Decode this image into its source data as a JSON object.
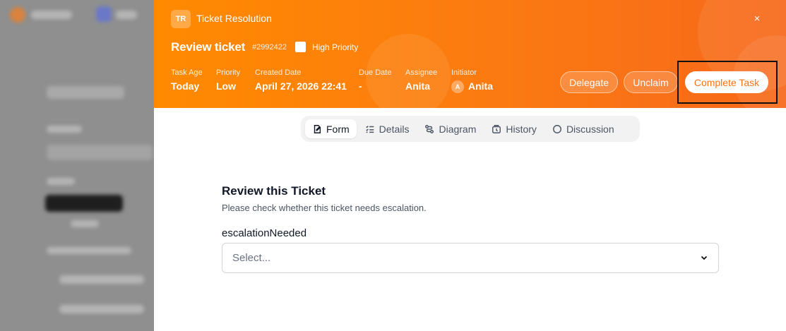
{
  "header": {
    "badge": "TR",
    "process_name": "Ticket Resolution",
    "close_glyph": "×",
    "title": "Review ticket",
    "ticket_id": "#2992422",
    "high_priority_label": "High Priority",
    "high_priority_checked": false,
    "meta": {
      "task_age_label": "Task Age",
      "task_age": "Today",
      "priority_label": "Priority",
      "priority": "Low",
      "created_label": "Created Date",
      "created": "April 27, 2026 22:41",
      "due_label": "Due Date",
      "due": "-",
      "assignee_label": "Assignee",
      "assignee": "Anita",
      "initiator_label": "Initiator",
      "initiator_initial": "A",
      "initiator": "Anita"
    },
    "actions": {
      "delegate": "Delegate",
      "unclaim": "Unclaim",
      "complete": "Complete Task"
    },
    "colors": {
      "accent": "#f97316",
      "gradient_start": "#ff8a00",
      "gradient_end": "#f7681a"
    }
  },
  "tabs": [
    {
      "label": "Form",
      "icon": "form-icon",
      "active": true
    },
    {
      "label": "Details",
      "icon": "list-icon",
      "active": false
    },
    {
      "label": "Diagram",
      "icon": "diagram-icon",
      "active": false
    },
    {
      "label": "History",
      "icon": "history-icon",
      "active": false
    },
    {
      "label": "Discussion",
      "icon": "chat-icon",
      "active": false
    }
  ],
  "form": {
    "title": "Review this Ticket",
    "description": "Please check whether this ticket needs escalation.",
    "field_label": "escalationNeeded",
    "select_placeholder": "Select..."
  }
}
